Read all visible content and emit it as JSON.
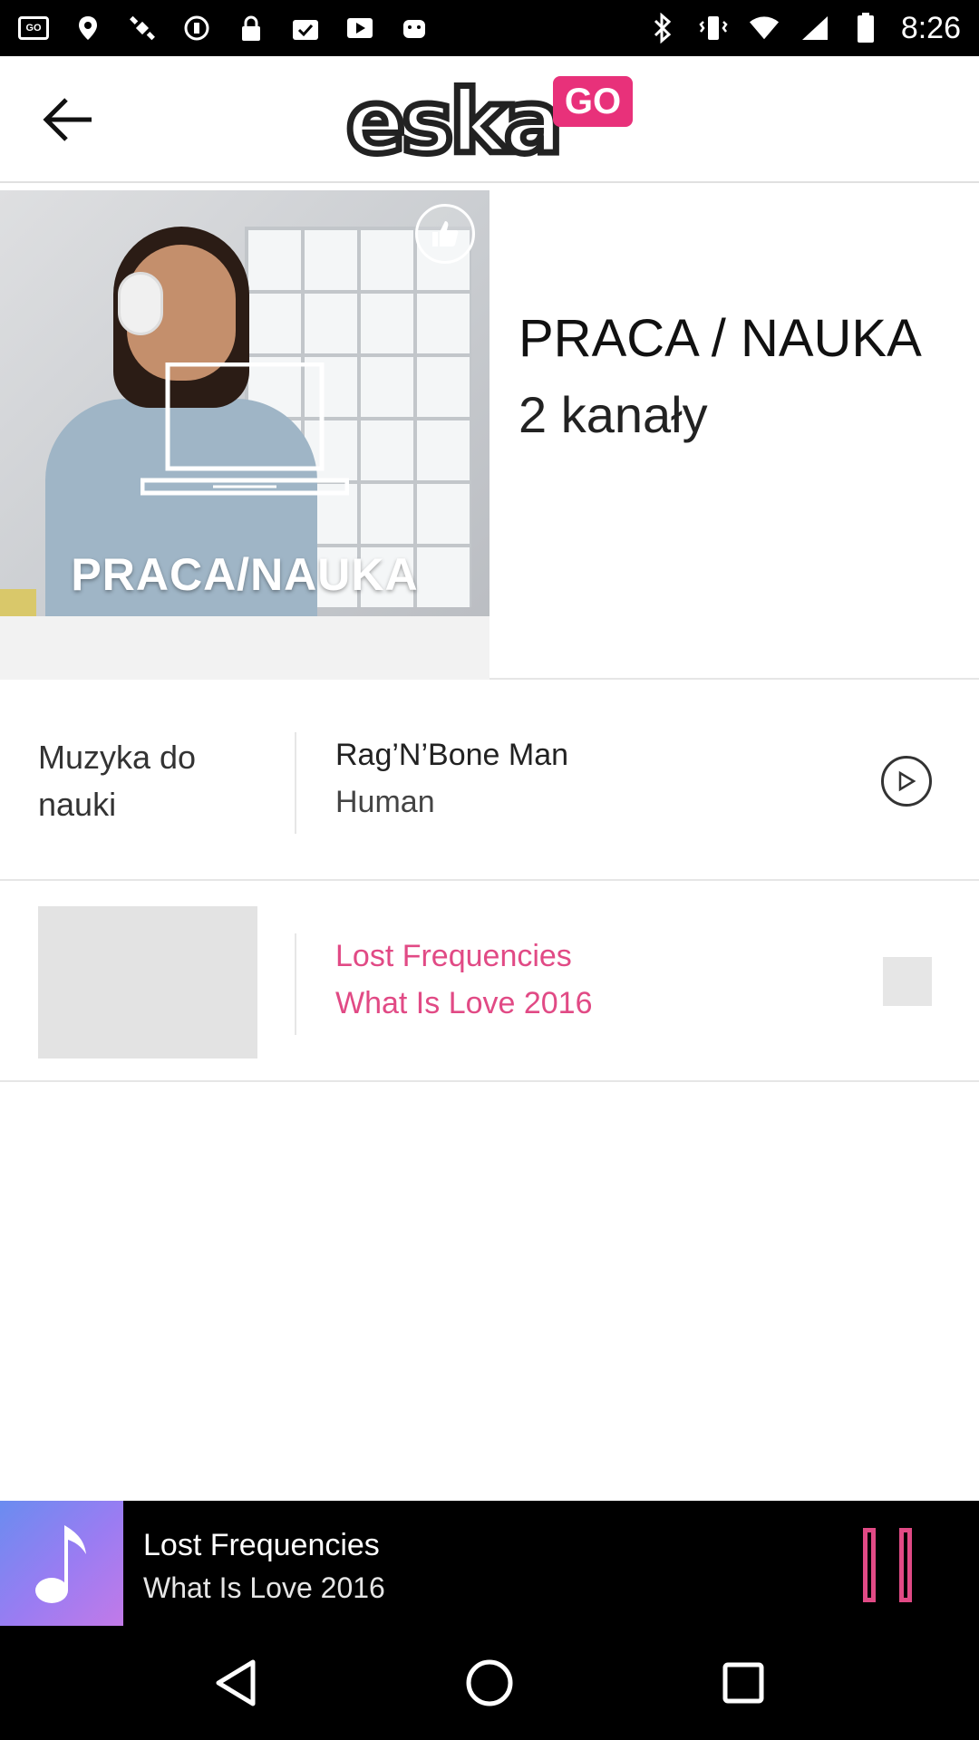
{
  "status_bar": {
    "time": "8:26",
    "left_icons": [
      "go-app-icon",
      "fake-gps-icon",
      "satellite-icon",
      "sync-icon",
      "lock-icon",
      "task-icon",
      "play-store-icon",
      "android-icon"
    ],
    "right_icons": [
      "bluetooth-icon",
      "vibrate-icon",
      "wifi-icon",
      "signal-icon",
      "battery-icon"
    ]
  },
  "header": {
    "logo_text": "eska",
    "logo_badge": "GO",
    "brand_color": "#e8317a"
  },
  "hero": {
    "image_caption": "PRACA/NAUKA",
    "title": "PRACA / NAUKA",
    "subtitle": "2 kanały"
  },
  "channels": [
    {
      "label": "Muzyka do nauki",
      "artist": "Rag’N’Bone Man",
      "track": "Human",
      "state": "stopped"
    },
    {
      "label": "",
      "artist": "Lost Frequencies",
      "track": "What Is Love 2016",
      "state": "playing"
    }
  ],
  "player": {
    "artist": "Lost Frequencies",
    "track": "What Is Love 2016"
  },
  "colors": {
    "accent": "#e14a85",
    "player_bg": "#000000",
    "art_gradient_start": "#6a8cf0",
    "art_gradient_end": "#c27ae8"
  }
}
